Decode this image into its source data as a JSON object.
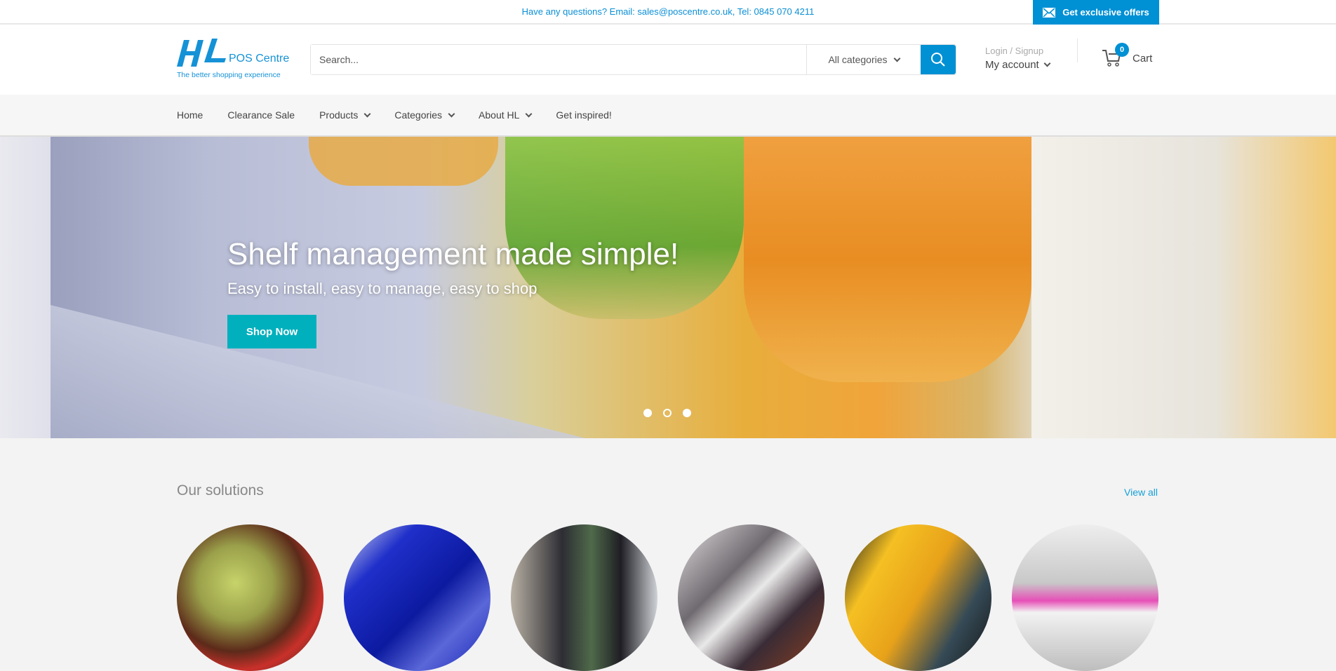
{
  "topbar": {
    "message": "Have any questions? Email: sales@poscentre.co.uk, Tel: 0845 070 4211",
    "offers_label": "Get exclusive offers",
    "offers_icon": "mail-icon"
  },
  "header": {
    "logo_text": "HL",
    "brand": "POS Centre",
    "tagline": "The better shopping experience",
    "search_placeholder": "Search...",
    "categories_label": "All categories",
    "login_label": "Login / Signup",
    "account_label": "My account",
    "cart_count": "0",
    "cart_label": "Cart"
  },
  "nav": {
    "items": [
      {
        "label": "Home"
      },
      {
        "label": "Clearance Sale"
      },
      {
        "label": "Products",
        "dropdown": true
      },
      {
        "label": "Categories",
        "dropdown": true
      },
      {
        "label": "About HL",
        "dropdown": true
      },
      {
        "label": "Get inspired!"
      }
    ]
  },
  "hero": {
    "title": "Shelf management made simple!",
    "subtitle": "Easy to install, easy to manage, easy to shop",
    "cta": "Shop Now",
    "slides": 3,
    "active_slide": 2
  },
  "solutions": {
    "title": "Our solutions",
    "view_all": "View all"
  },
  "colors": {
    "brand": "#0090d4",
    "cta": "#00b0bd"
  }
}
